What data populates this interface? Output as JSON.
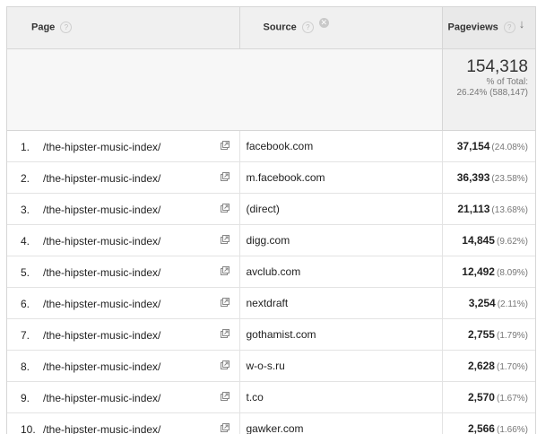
{
  "headers": {
    "page": "Page",
    "source": "Source",
    "pageviews": "Pageviews",
    "help_glyph": "?",
    "clear_glyph": "✕",
    "sort_glyph": "↓"
  },
  "totals": {
    "pageviews": "154,318",
    "pct_label": "% of Total:",
    "pct_value": "26.24% (588,147)"
  },
  "rows": [
    {
      "index": "1.",
      "page": "/the-hipster-music-index/",
      "source": "facebook.com",
      "pageviews": "37,154",
      "pct": "(24.08%)"
    },
    {
      "index": "2.",
      "page": "/the-hipster-music-index/",
      "source": "m.facebook.com",
      "pageviews": "36,393",
      "pct": "(23.58%)"
    },
    {
      "index": "3.",
      "page": "/the-hipster-music-index/",
      "source": "(direct)",
      "pageviews": "21,113",
      "pct": "(13.68%)"
    },
    {
      "index": "4.",
      "page": "/the-hipster-music-index/",
      "source": "digg.com",
      "pageviews": "14,845",
      "pct": "(9.62%)"
    },
    {
      "index": "5.",
      "page": "/the-hipster-music-index/",
      "source": "avclub.com",
      "pageviews": "12,492",
      "pct": "(8.09%)"
    },
    {
      "index": "6.",
      "page": "/the-hipster-music-index/",
      "source": "nextdraft",
      "pageviews": "3,254",
      "pct": "(2.11%)"
    },
    {
      "index": "7.",
      "page": "/the-hipster-music-index/",
      "source": "gothamist.com",
      "pageviews": "2,755",
      "pct": "(1.79%)"
    },
    {
      "index": "8.",
      "page": "/the-hipster-music-index/",
      "source": "w-o-s.ru",
      "pageviews": "2,628",
      "pct": "(1.70%)"
    },
    {
      "index": "9.",
      "page": "/the-hipster-music-index/",
      "source": "t.co",
      "pageviews": "2,570",
      "pct": "(1.67%)"
    },
    {
      "index": "10.",
      "page": "/the-hipster-music-index/",
      "source": "gawker.com",
      "pageviews": "2,566",
      "pct": "(1.66%)"
    }
  ]
}
